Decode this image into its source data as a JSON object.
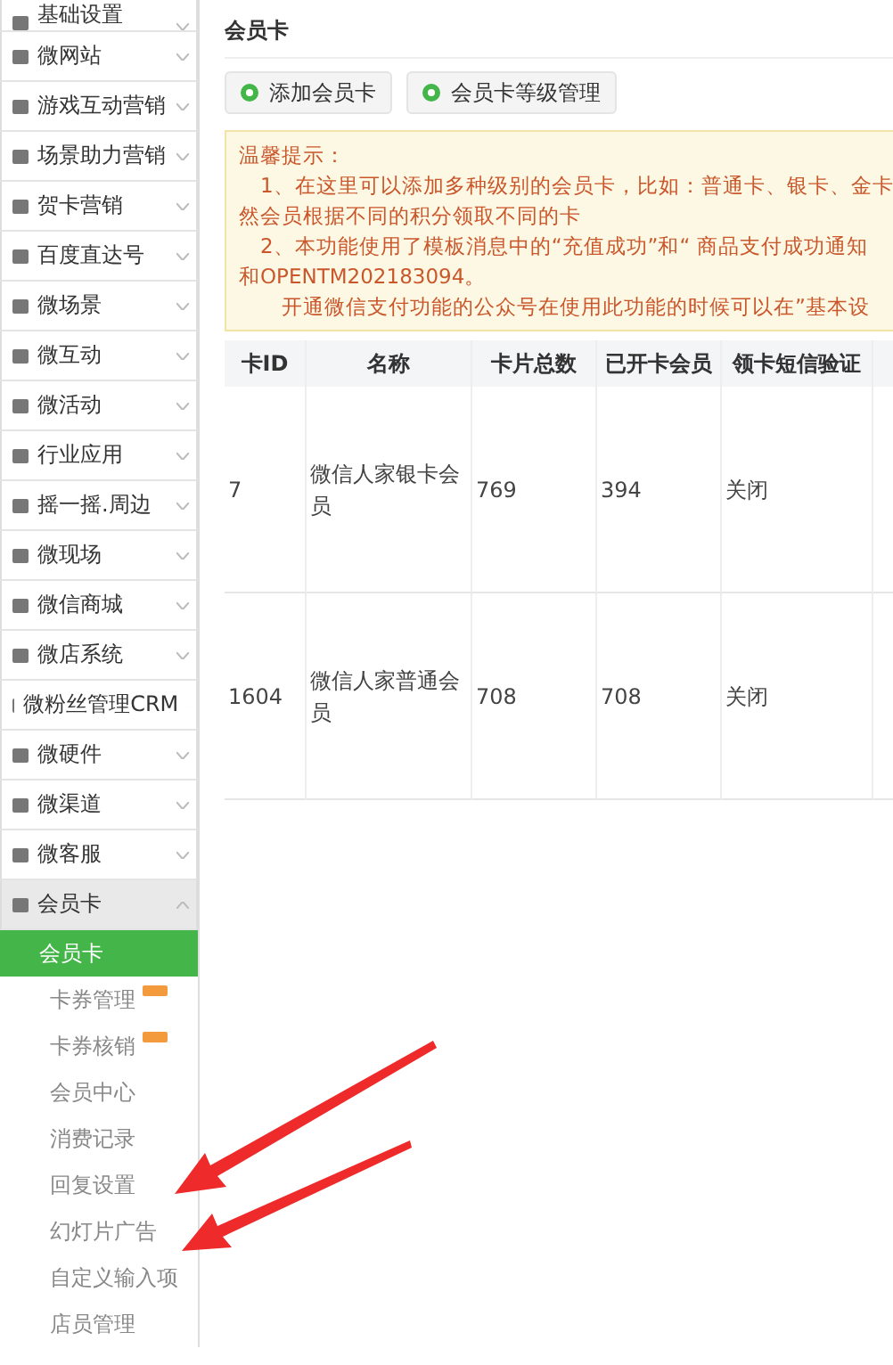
{
  "sidebar": {
    "items": [
      {
        "label": "基础设置",
        "expanded": false
      },
      {
        "label": "微网站",
        "expanded": false
      },
      {
        "label": "游戏互动营销",
        "expanded": false
      },
      {
        "label": "场景助力营销",
        "expanded": false
      },
      {
        "label": "贺卡营销",
        "expanded": false
      },
      {
        "label": "百度直达号",
        "expanded": false
      },
      {
        "label": "微场景",
        "expanded": false
      },
      {
        "label": "微互动",
        "expanded": false
      },
      {
        "label": "微活动",
        "expanded": false
      },
      {
        "label": "行业应用",
        "expanded": false
      },
      {
        "label": "摇一摇.周边",
        "expanded": false
      },
      {
        "label": "微现场",
        "expanded": false
      },
      {
        "label": "微信商城",
        "expanded": false
      },
      {
        "label": "微店系统",
        "expanded": false
      },
      {
        "label": "微粉丝管理CRM",
        "expanded": false
      },
      {
        "label": "微硬件",
        "expanded": false
      },
      {
        "label": "微渠道",
        "expanded": false
      },
      {
        "label": "微客服",
        "expanded": false
      },
      {
        "label": "会员卡",
        "expanded": true,
        "children": [
          {
            "label": "会员卡",
            "selected": true,
            "badge": false
          },
          {
            "label": "卡券管理",
            "selected": false,
            "badge": true
          },
          {
            "label": "卡券核销",
            "selected": false,
            "badge": true
          },
          {
            "label": "会员中心",
            "selected": false,
            "badge": false
          },
          {
            "label": "消费记录",
            "selected": false,
            "badge": false
          },
          {
            "label": "回复设置",
            "selected": false,
            "badge": false
          },
          {
            "label": "幻灯片广告",
            "selected": false,
            "badge": false
          },
          {
            "label": "自定义输入项",
            "selected": false,
            "badge": false
          },
          {
            "label": "店员管理",
            "selected": false,
            "badge": false
          }
        ]
      }
    ]
  },
  "page_title": "会员卡",
  "buttons": [
    "添加会员卡",
    "会员卡等级管理"
  ],
  "notice": {
    "title": "温馨提示：",
    "lines": [
      "1、在这里可以添加多种级别的会员卡，比如：普通卡、银卡、金卡",
      "然会员根据不同的积分领取不同的卡",
      "2、本功能使用了模板消息中的“充值成功”和“ 商品支付成功通知",
      "和OPENTM202183094。",
      "开通微信支付功能的公众号在使用此功能的时候可以在”基本设"
    ]
  },
  "table": {
    "columns": [
      "卡ID",
      "名称",
      "卡片总数",
      "已开卡会员",
      "领卡短信验证"
    ],
    "rows": [
      [
        "7",
        "微信人家银卡会员",
        "769",
        "394",
        "关闭"
      ],
      [
        "1604",
        "微信人家普通会员",
        "708",
        "708",
        "关闭"
      ]
    ]
  }
}
